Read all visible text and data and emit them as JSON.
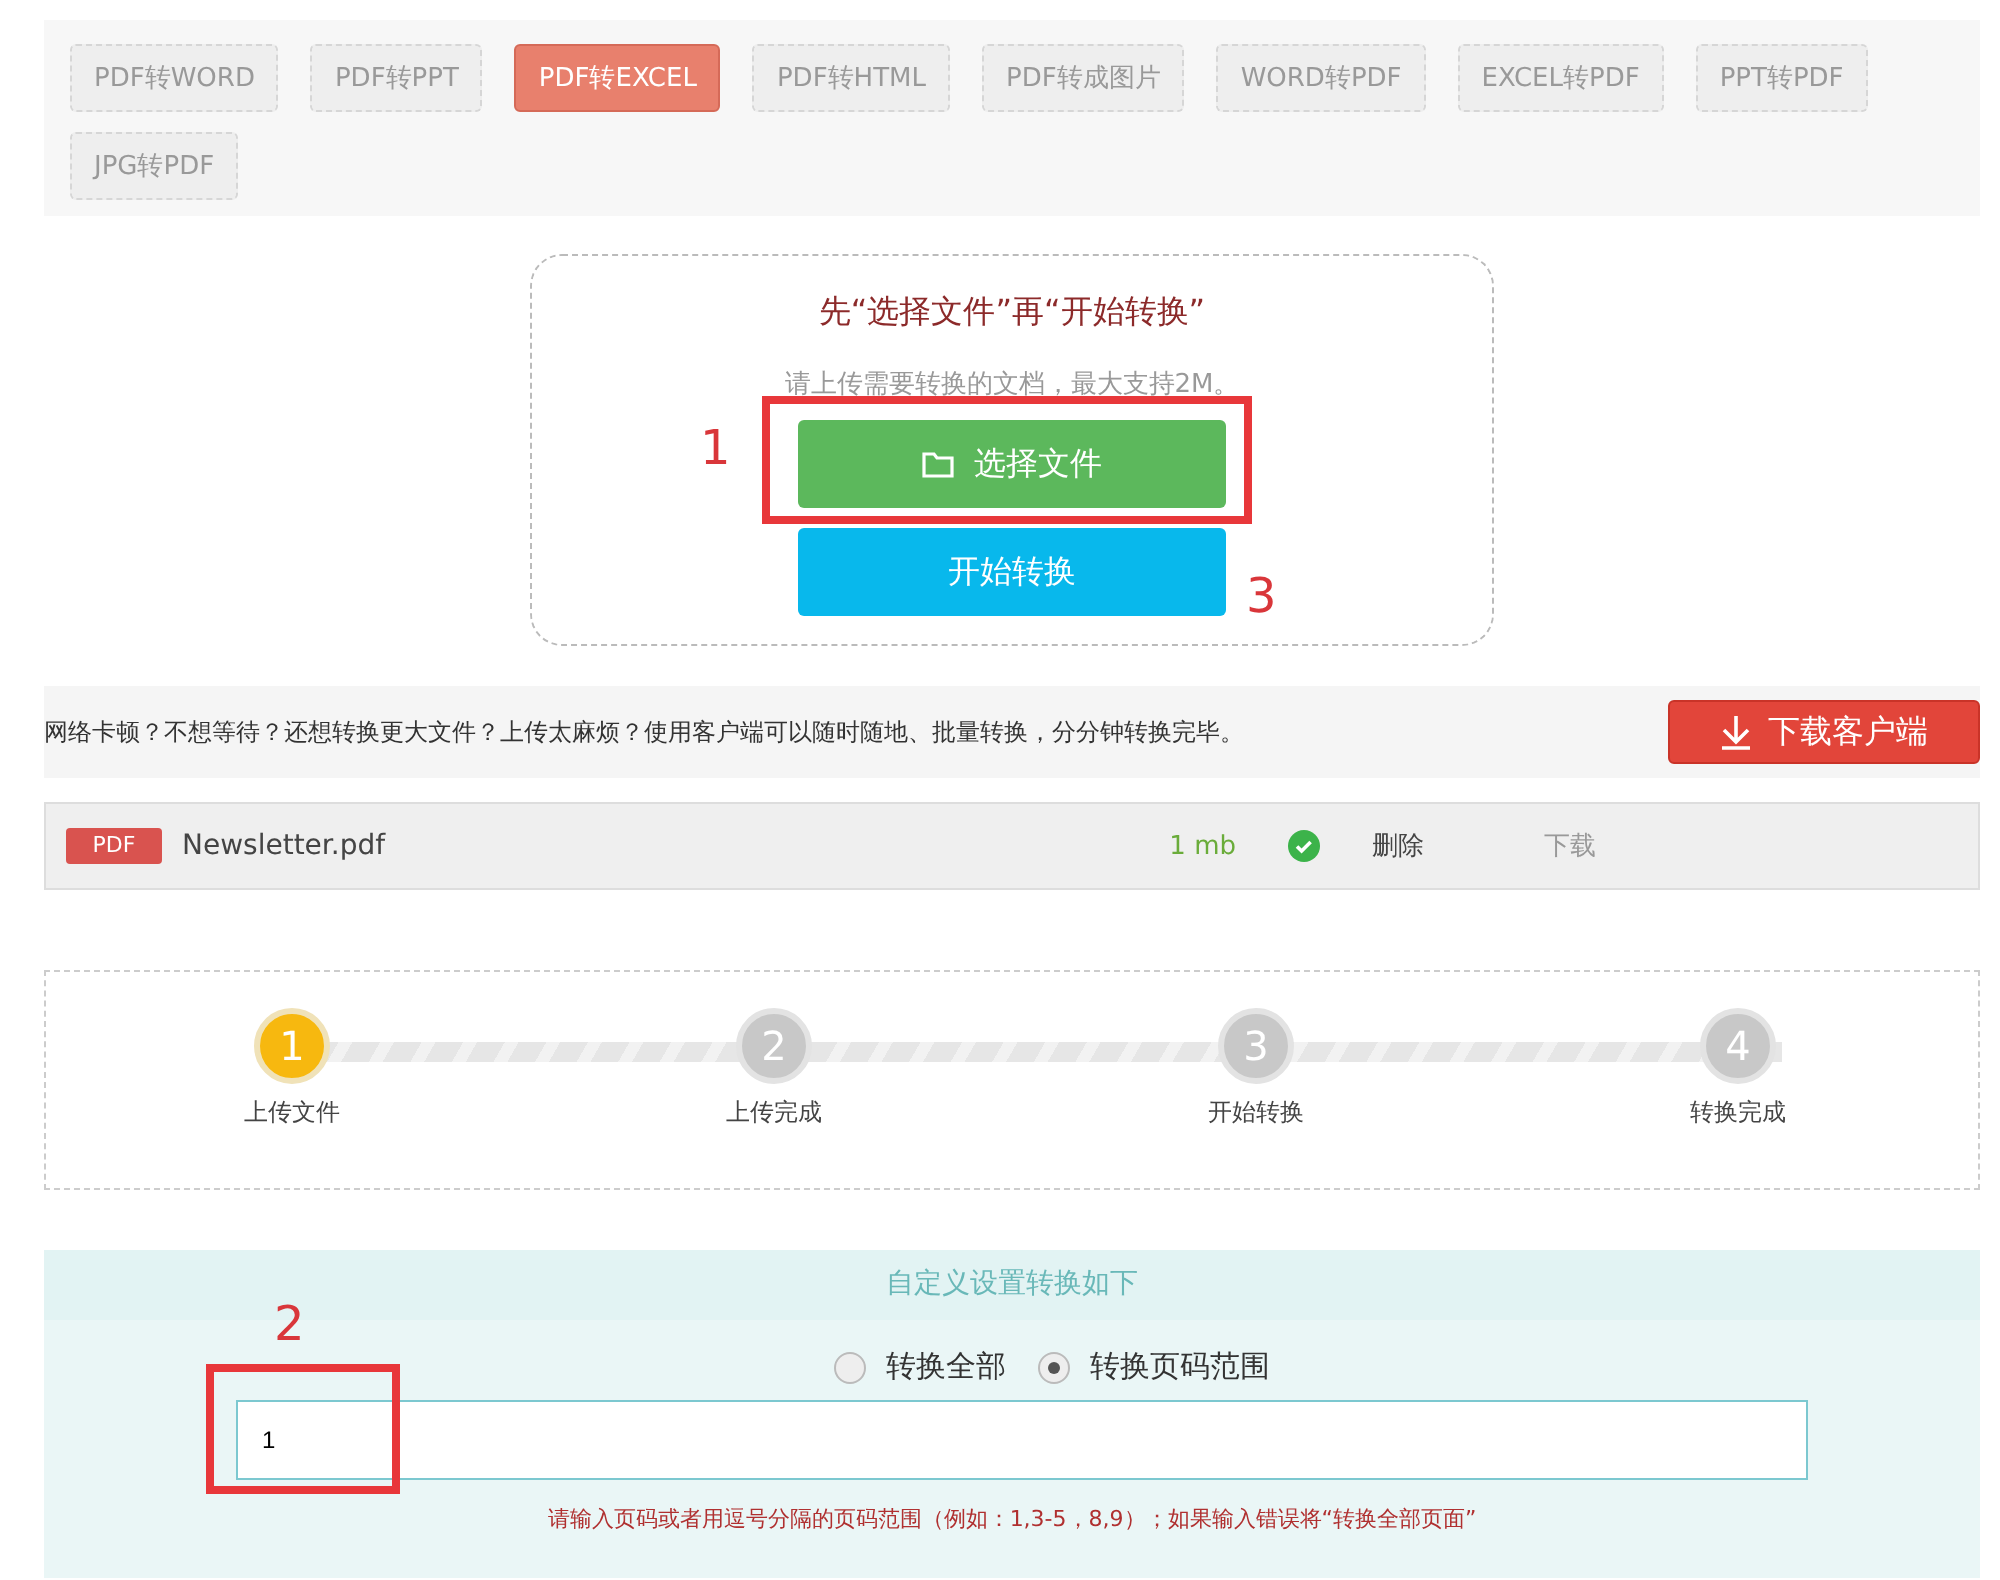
{
  "tabs": [
    {
      "label": "PDF转WORD",
      "selected": false
    },
    {
      "label": "PDF转PPT",
      "selected": false
    },
    {
      "label": "PDF转EXCEL",
      "selected": true
    },
    {
      "label": "PDF转HTML",
      "selected": false
    },
    {
      "label": "PDF转成图片",
      "selected": false
    },
    {
      "label": "WORD转PDF",
      "selected": false
    },
    {
      "label": "EXCEL转PDF",
      "selected": false
    },
    {
      "label": "PPT转PDF",
      "selected": false
    },
    {
      "label": "JPG转PDF",
      "selected": false
    }
  ],
  "upload": {
    "title": "先“选择文件”再“开始转换”",
    "hint": "请上传需要转换的文档，最大支持2M。",
    "choose_button": "选择文件",
    "start_button": "开始转换"
  },
  "annotations": [
    {
      "number": "1"
    },
    {
      "number": "3"
    },
    {
      "number": "2"
    }
  ],
  "promo": {
    "text": "网络卡顿？不想等待？还想转换更大文件？上传太麻烦？使用客户端可以随时随地、批量转换，分分钟转换完毕。",
    "button": "下载客户端"
  },
  "file": {
    "badge": "PDF",
    "name": "Newsletter.pdf",
    "size": "1 mb",
    "uploaded": true,
    "delete": "删除",
    "download": "下载",
    "download_disabled": true
  },
  "steps": [
    {
      "number": "1",
      "label": "上传文件",
      "active": true
    },
    {
      "number": "2",
      "label": "上传完成",
      "active": false
    },
    {
      "number": "3",
      "label": "开始转换",
      "active": false
    },
    {
      "number": "4",
      "label": "转换完成",
      "active": false
    }
  ],
  "settings": {
    "header": "自定义设置转换如下",
    "options": [
      {
        "label": "转换全部",
        "selected": false
      },
      {
        "label": "转换页码范围",
        "selected": true
      }
    ],
    "range_value": "1",
    "hint": "请输入页码或者用逗号分隔的页码范围（例如：1,3-5，8,9）；如果输入错误将“转换全部页面”"
  }
}
